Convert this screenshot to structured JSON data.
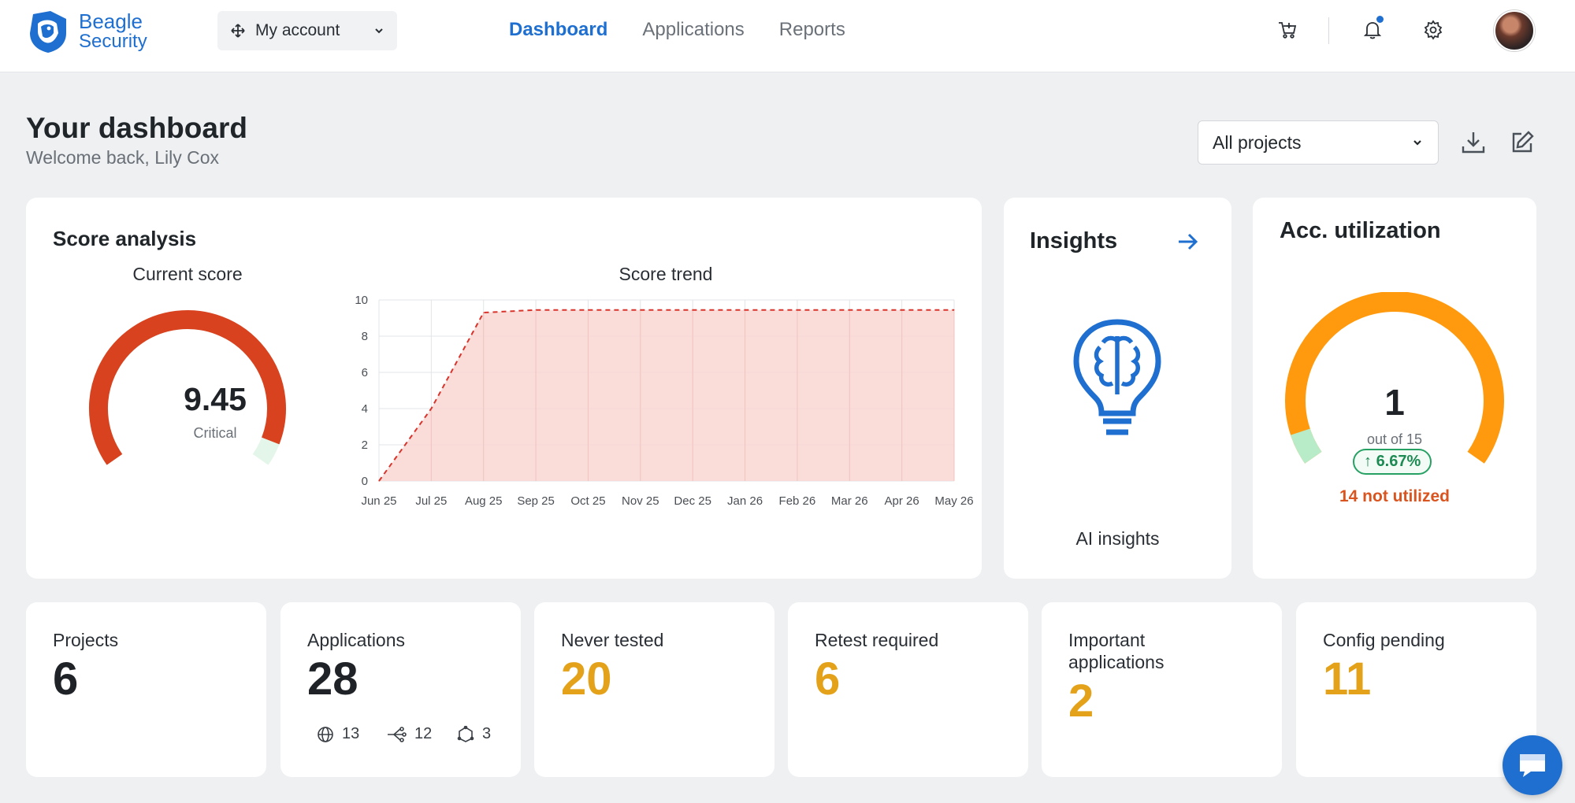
{
  "brand": {
    "line1": "Beagle",
    "line2": "Security"
  },
  "account": {
    "label": "My account"
  },
  "nav": [
    {
      "label": "Dashboard",
      "active": true
    },
    {
      "label": "Applications",
      "active": false
    },
    {
      "label": "Reports",
      "active": false
    }
  ],
  "header_icons": [
    "cart-icon",
    "bell-icon",
    "gear-icon",
    "avatar"
  ],
  "page": {
    "title": "Your dashboard",
    "subtitle": "Welcome back, Lily Cox"
  },
  "project_filter": {
    "selected": "All projects"
  },
  "score_analysis": {
    "title": "Score analysis",
    "current_score_label": "Current score",
    "score": "9.45",
    "score_level": "Critical",
    "score_fraction": 0.945,
    "trend_label": "Score trend"
  },
  "chart_data": {
    "type": "area",
    "title": "Score trend",
    "x": [
      "Jun 25",
      "Jul 25",
      "Aug 25",
      "Sep 25",
      "Oct 25",
      "Nov 25",
      "Dec 25",
      "Jan 26",
      "Feb 26",
      "Mar 26",
      "Apr 26",
      "May 26"
    ],
    "series": [
      {
        "values": [
          0,
          4.0,
          9.3,
          9.45,
          9.45,
          9.45,
          9.45,
          9.45,
          9.45,
          9.45,
          9.45,
          9.45
        ]
      }
    ],
    "ylim": [
      0,
      10
    ],
    "yticks": [
      0,
      2,
      4,
      6,
      8,
      10
    ],
    "grid": true,
    "fill_color": "#f9d6d2",
    "line_color": "#d9342b"
  },
  "insights": {
    "title": "Insights",
    "caption": "AI insights"
  },
  "utilization": {
    "title": "Acc. utilization",
    "used": "1",
    "out_of": "out of 15",
    "percent": "6.67%",
    "not_utilized": "14 not utilized",
    "used_fraction": 0.0667
  },
  "stats": [
    {
      "label": "Projects",
      "value": "6",
      "tone": "dark"
    },
    {
      "label": "Applications",
      "value": "28",
      "tone": "dark"
    },
    {
      "label": "Never tested",
      "value": "20",
      "tone": "amber"
    },
    {
      "label": "Retest required",
      "value": "6",
      "tone": "amber"
    },
    {
      "label": "Important applications",
      "value": "2",
      "tone": "amber"
    },
    {
      "label": "Config pending",
      "value": "11",
      "tone": "amber"
    }
  ],
  "app_breakdown": {
    "web": "13",
    "api": "12",
    "other": "3"
  },
  "colors": {
    "accent": "#1e6fd0",
    "critical": "#d9421f",
    "amber": "#e3a21a",
    "orange": "#ff9a0f",
    "success": "#27a163"
  }
}
